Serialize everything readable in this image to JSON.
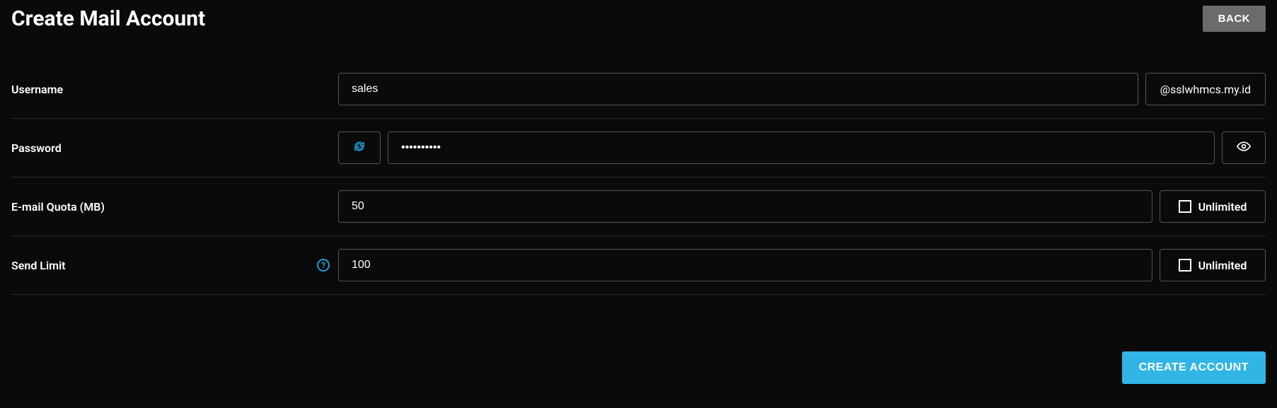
{
  "header": {
    "title": "Create Mail Account",
    "back_label": "BACK"
  },
  "fields": {
    "username": {
      "label": "Username",
      "value": "sales",
      "domain": "@sslwhmcs.my.id"
    },
    "password": {
      "label": "Password",
      "value": "••••••••••"
    },
    "quota": {
      "label": "E-mail Quota (MB)",
      "value": "50",
      "unlimited_label": "Unlimited"
    },
    "send_limit": {
      "label": "Send Limit",
      "value": "100",
      "unlimited_label": "Unlimited",
      "help": "?"
    }
  },
  "footer": {
    "create_label": "CREATE ACCOUNT"
  }
}
